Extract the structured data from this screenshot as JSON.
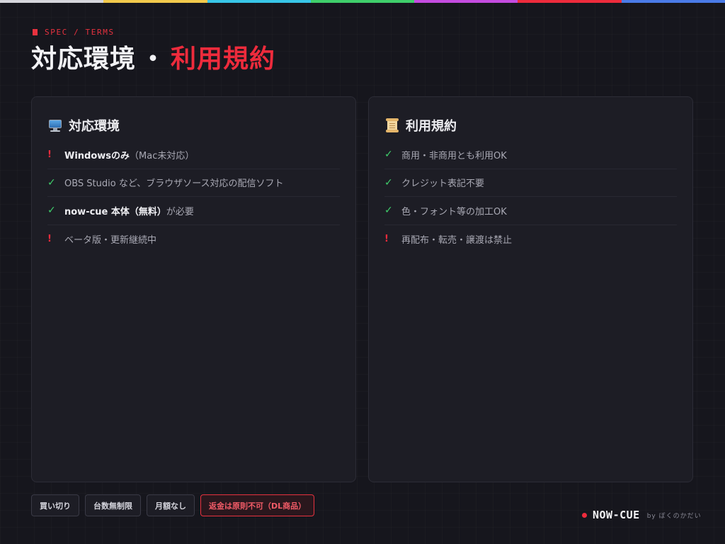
{
  "header": {
    "kicker": "SPEC / TERMS",
    "title_main": "対応環境",
    "title_sep": "・",
    "title_accent": "利用規約"
  },
  "colors": {
    "accent": "#ee2b3c",
    "ok": "#3fcf6b",
    "background": "#16161d",
    "panel": "#1d1d25",
    "rainbow": [
      "#d6d6dc",
      "#f2c94c",
      "#38c6e8",
      "#3fcf6b",
      "#c44ce0",
      "#ee2b3c",
      "#4a7be8"
    ]
  },
  "panels": {
    "environment": {
      "icon": "desktop-computer-icon",
      "title": "対応環境",
      "items": [
        {
          "status": "warn",
          "mark": "!",
          "bold": "Windowsのみ",
          "text": "（Mac未対応）"
        },
        {
          "status": "ok",
          "mark": "✓",
          "bold": "",
          "text": "OBS Studio など、ブラウザソース対応の配信ソフト"
        },
        {
          "status": "ok",
          "mark": "✓",
          "bold": "now-cue 本体（無料）",
          "text": "が必要"
        },
        {
          "status": "warn",
          "mark": "!",
          "bold": "",
          "text": "ベータ版・更新継続中"
        }
      ]
    },
    "terms": {
      "icon": "scroll-icon",
      "title": "利用規約",
      "items": [
        {
          "status": "ok",
          "mark": "✓",
          "bold": "",
          "text": "商用・非商用とも利用OK"
        },
        {
          "status": "ok",
          "mark": "✓",
          "bold": "",
          "text": "クレジット表記不要"
        },
        {
          "status": "ok",
          "mark": "✓",
          "bold": "",
          "text": "色・フォント等の加工OK"
        },
        {
          "status": "warn",
          "mark": "!",
          "bold": "",
          "text": "再配布・転売・譲渡は禁止"
        }
      ]
    }
  },
  "tags": [
    {
      "label": "買い切り",
      "alert": false
    },
    {
      "label": "台数無制限",
      "alert": false
    },
    {
      "label": "月額なし",
      "alert": false
    },
    {
      "label": "返金は原則不可（DL商品）",
      "alert": true
    }
  ],
  "brand": {
    "name": "NOW-CUE",
    "by": "by ぼくのかだい"
  }
}
